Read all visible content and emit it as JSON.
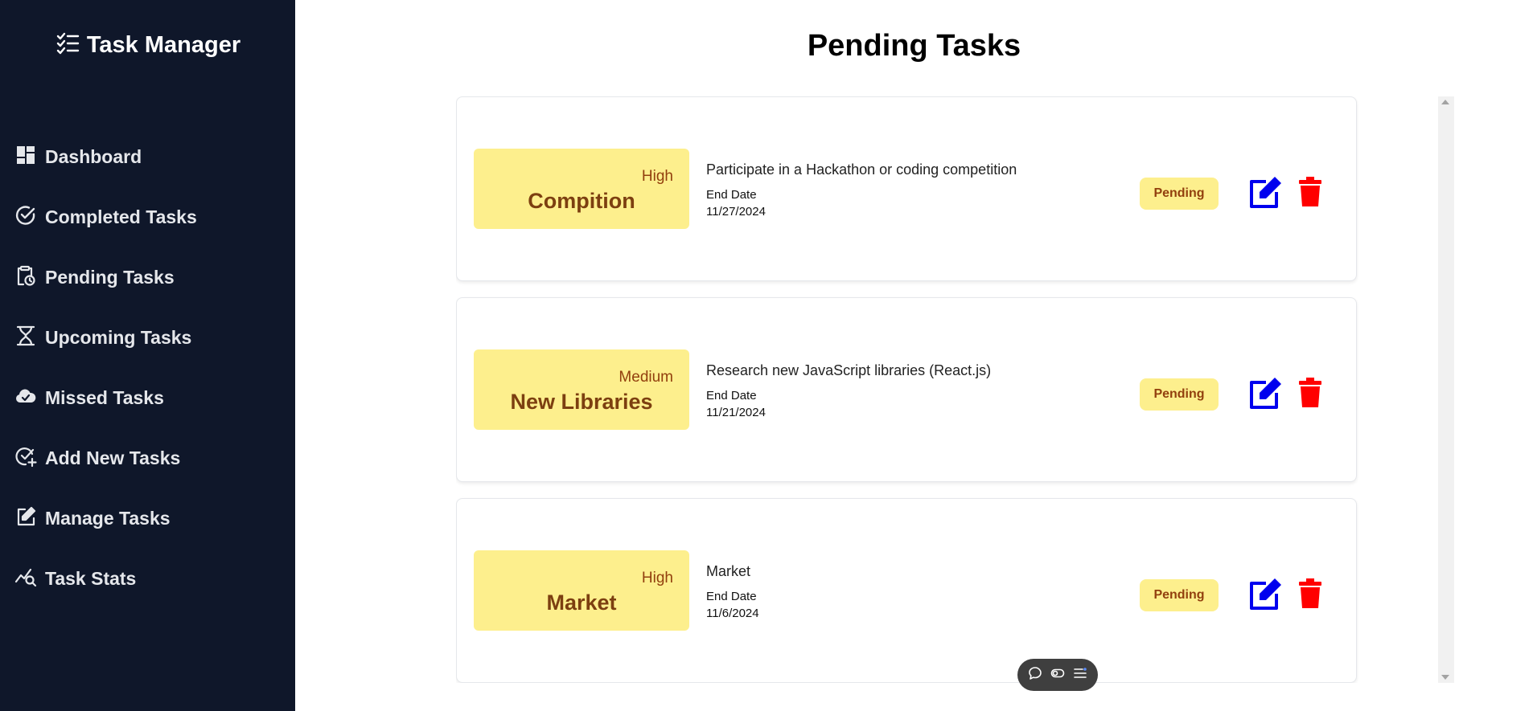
{
  "app": {
    "title": "Task Manager"
  },
  "sidebar": {
    "items": [
      {
        "label": "Dashboard",
        "icon": "dashboard-icon"
      },
      {
        "label": "Completed Tasks",
        "icon": "check-circle-icon"
      },
      {
        "label": "Pending Tasks",
        "icon": "clipboard-clock-icon"
      },
      {
        "label": "Upcoming Tasks",
        "icon": "hourglass-icon"
      },
      {
        "label": "Missed Tasks",
        "icon": "cloud-check-icon"
      },
      {
        "label": "Add New Tasks",
        "icon": "add-task-icon"
      },
      {
        "label": "Manage Tasks",
        "icon": "edit-square-icon"
      },
      {
        "label": "Task Stats",
        "icon": "stats-search-icon"
      }
    ]
  },
  "main": {
    "page_title": "Pending Tasks",
    "end_date_label": "End Date",
    "tasks": [
      {
        "title": "Compition",
        "priority": "High",
        "description": "Participate in a Hackathon or coding competition",
        "end_date": "11/27/2024",
        "status": "Pending"
      },
      {
        "title": "New Libraries",
        "priority": "Medium",
        "description": "Research new JavaScript libraries (React.js)",
        "end_date": "11/21/2024",
        "status": "Pending"
      },
      {
        "title": "Market",
        "priority": "High",
        "description": "Market",
        "end_date": "11/6/2024",
        "status": "Pending"
      }
    ]
  },
  "colors": {
    "sidebar_bg": "#0f172a",
    "badge_bg": "#fdef8d",
    "badge_text": "#7c3f10",
    "edit": "#0000ee",
    "delete": "#ff0000"
  },
  "floating_toolbar": {
    "icons": [
      "chat-icon",
      "toggle-icon",
      "menu-icon"
    ]
  }
}
